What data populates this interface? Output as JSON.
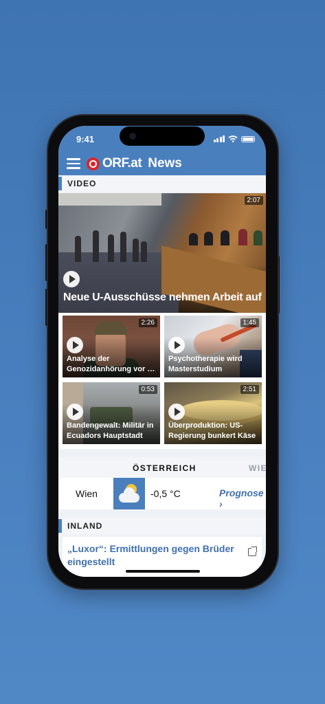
{
  "status_bar": {
    "time": "9:41"
  },
  "header": {
    "logo": "ORF.at",
    "title": "News"
  },
  "video_section": {
    "label": "VIDEO",
    "hero": {
      "title": "Neue U-Ausschüsse nehmen Arbeit auf",
      "duration": "2:07"
    },
    "tiles": [
      {
        "line1": "Analyse der",
        "line2": "Genozidanhörung vor UN…",
        "duration": "2:26"
      },
      {
        "line1": "Psychotherapie wird",
        "line2": "Masterstudium",
        "duration": "1:45"
      },
      {
        "line1": "Bandengewalt: Militär in",
        "line2": "Ecuadors Hauptstadt",
        "duration": "0:53"
      },
      {
        "line1": "Überproduktion: US-",
        "line2": "Regierung bunkert Käse",
        "duration": "2:51"
      }
    ]
  },
  "region": {
    "active_tab": "ÖSTERREICH",
    "next_tab": "WIE",
    "weather": {
      "city": "Wien",
      "temperature": "-0,5 °C",
      "forecast_link": "Prognose ›",
      "icon": "partly-cloudy-icon"
    }
  },
  "inland_section": {
    "label": "INLAND",
    "article": {
      "line1": "„Luxor“: Ermittlungen gegen Brüder",
      "line2": "eingestellt"
    }
  },
  "colors": {
    "brand_blue": "#4a7fbe",
    "orf_red": "#d7282f",
    "link_blue": "#3f6fae"
  }
}
